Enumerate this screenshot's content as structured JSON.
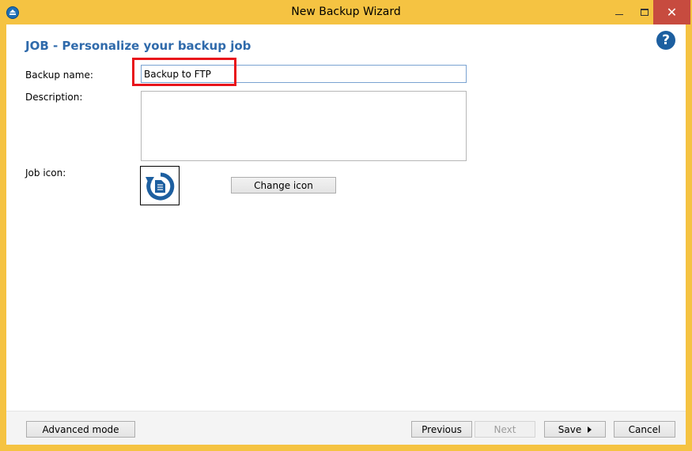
{
  "window": {
    "title": "New Backup Wizard",
    "frame_color": "#f5c342",
    "close_glyph": "✕"
  },
  "page": {
    "heading": "JOB - Personalize your backup job",
    "help_glyph": "?"
  },
  "form": {
    "backup_name_label": "Backup name:",
    "backup_name_value": "Backup to FTP",
    "description_label": "Description:",
    "description_value": "",
    "job_icon_label": "Job icon:",
    "job_icon_name": "backup-document-icon",
    "change_icon_label": "Change icon"
  },
  "footer": {
    "advanced_mode": "Advanced mode",
    "previous": "Previous",
    "next": "Next",
    "save": "Save",
    "cancel": "Cancel"
  },
  "colors": {
    "heading": "#2f6aab",
    "highlight": "#e8141b",
    "icon_blue": "#1d5fa0"
  }
}
